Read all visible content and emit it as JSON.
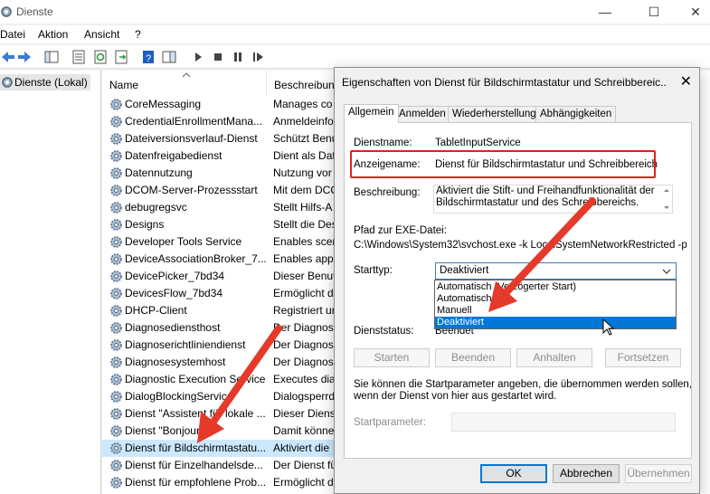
{
  "window": {
    "title": "Dienste"
  },
  "menu": [
    "Datei",
    "Aktion",
    "Ansicht",
    "?"
  ],
  "tree": {
    "root": "Dienste (Lokal)"
  },
  "list": {
    "columns": [
      "Name",
      "Beschreibung"
    ],
    "rows": [
      {
        "name": "CoreMessaging",
        "desc": "Manages co"
      },
      {
        "name": "CredentialEnrollmentMana...",
        "desc": "Anmeldeinfo"
      },
      {
        "name": "Dateiversionsverlauf-Dienst",
        "desc": "Schützt Benu"
      },
      {
        "name": "Datenfreigabedienst",
        "desc": "Dient als Dat"
      },
      {
        "name": "Datennutzung",
        "desc": "Nutzung vor"
      },
      {
        "name": "DCOM-Server-Prozessstart",
        "desc": "Mit dem DCO"
      },
      {
        "name": "debugregsvc",
        "desc": "Stellt Hilfs-A"
      },
      {
        "name": "Designs",
        "desc": "Stellt die Des"
      },
      {
        "name": "Developer Tools Service",
        "desc": "Enables scen"
      },
      {
        "name": "DeviceAssociationBroker_7...",
        "desc": "Enables apps"
      },
      {
        "name": "DevicePicker_7bd34",
        "desc": "Dieser Benut"
      },
      {
        "name": "DevicesFlow_7bd34",
        "desc": "Ermöglicht d"
      },
      {
        "name": "DHCP-Client",
        "desc": "Registriert ur"
      },
      {
        "name": "Diagnosediensthost",
        "desc": "Der Diagnose"
      },
      {
        "name": "Diagnoserichtliniendienst",
        "desc": "Der Diagnose"
      },
      {
        "name": "Diagnosesystemhost",
        "desc": "Der Diagnose"
      },
      {
        "name": "Diagnostic Execution Service",
        "desc": "Executes diag"
      },
      {
        "name": "DialogBlockingService",
        "desc": "Dialogsperrd"
      },
      {
        "name": "Dienst \"Assistent für lokale ...",
        "desc": "Dieser Dienst"
      },
      {
        "name": "Dienst \"Bonjour\"",
        "desc": "Damit könne"
      },
      {
        "name": "Dienst für Bildschirmtastatu...",
        "desc": "Aktiviert die"
      },
      {
        "name": "Dienst für Einzelhandelsde...",
        "desc": "Der Dienst fü"
      },
      {
        "name": "Dienst für empfohlene Prob...",
        "desc": "Ermöglicht d"
      }
    ],
    "selected_index": 20
  },
  "dialog": {
    "title": "Eigenschaften von Dienst für Bildschirmtastatur und Schreibbereic...",
    "tabs": [
      "Allgemein",
      "Anmelden",
      "Wiederherstellung",
      "Abhängigkeiten"
    ],
    "labels": {
      "dienstname": "Dienstname:",
      "anzeigename": "Anzeigename:",
      "beschreibung": "Beschreibung:",
      "pfad": "Pfad zur EXE-Datei:",
      "starttyp": "Starttyp:",
      "dienststatus": "Dienststatus:",
      "hint_line1": "Sie können die Startparameter angeben, die übernommen werden sollen,",
      "hint_line2": "wenn der Dienst von hier aus gestartet wird.",
      "startparameter": "Startparameter:"
    },
    "values": {
      "dienstname": "TabletInputService",
      "anzeigename": "Dienst für Bildschirmtastatur und Schreibbereich",
      "beschreibung_line1": "Aktiviert die Stift- und Freihandfunktionalität der",
      "beschreibung_line2": "Bildschirmtastatur und des Schreibbereichs.",
      "pfad": "C:\\Windows\\System32\\svchost.exe -k LocalSystemNetworkRestricted -p",
      "starttyp": "Deaktiviert",
      "dienststatus": "Beendet"
    },
    "starttyp_options": [
      "Automatisch (Verzögerter Start)",
      "Automatisch",
      "Manuell",
      "Deaktiviert"
    ],
    "starttyp_highlighted": "Deaktiviert",
    "service_buttons": [
      "Starten",
      "Beenden",
      "Anhalten",
      "Fortsetzen"
    ],
    "footer_buttons": {
      "ok": "OK",
      "cancel": "Abbrechen",
      "apply": "Übernehmen"
    }
  },
  "colors": {
    "highlight": "#0078d7",
    "annotation": "#e02020",
    "selection": "#cce8ff"
  }
}
